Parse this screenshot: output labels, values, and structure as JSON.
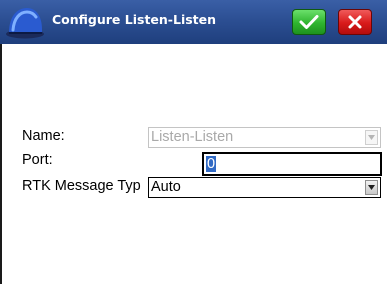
{
  "window": {
    "title": "Configure Listen-Listen",
    "app_icon": "helmet-icon",
    "ok_icon": "checkmark-icon",
    "cancel_icon": "close-icon"
  },
  "colors": {
    "titlebar": "#2c4f93",
    "ok_button": "#2fb42f",
    "cancel_button": "#d81a1a",
    "selection": "#316ac5"
  },
  "form": {
    "name": {
      "label": "Name:",
      "value": "Listen-Listen",
      "disabled": true
    },
    "port": {
      "label": "Port:",
      "value": "0"
    },
    "rtk_message_type": {
      "label": "RTK Message Typ",
      "value": "Auto"
    }
  }
}
